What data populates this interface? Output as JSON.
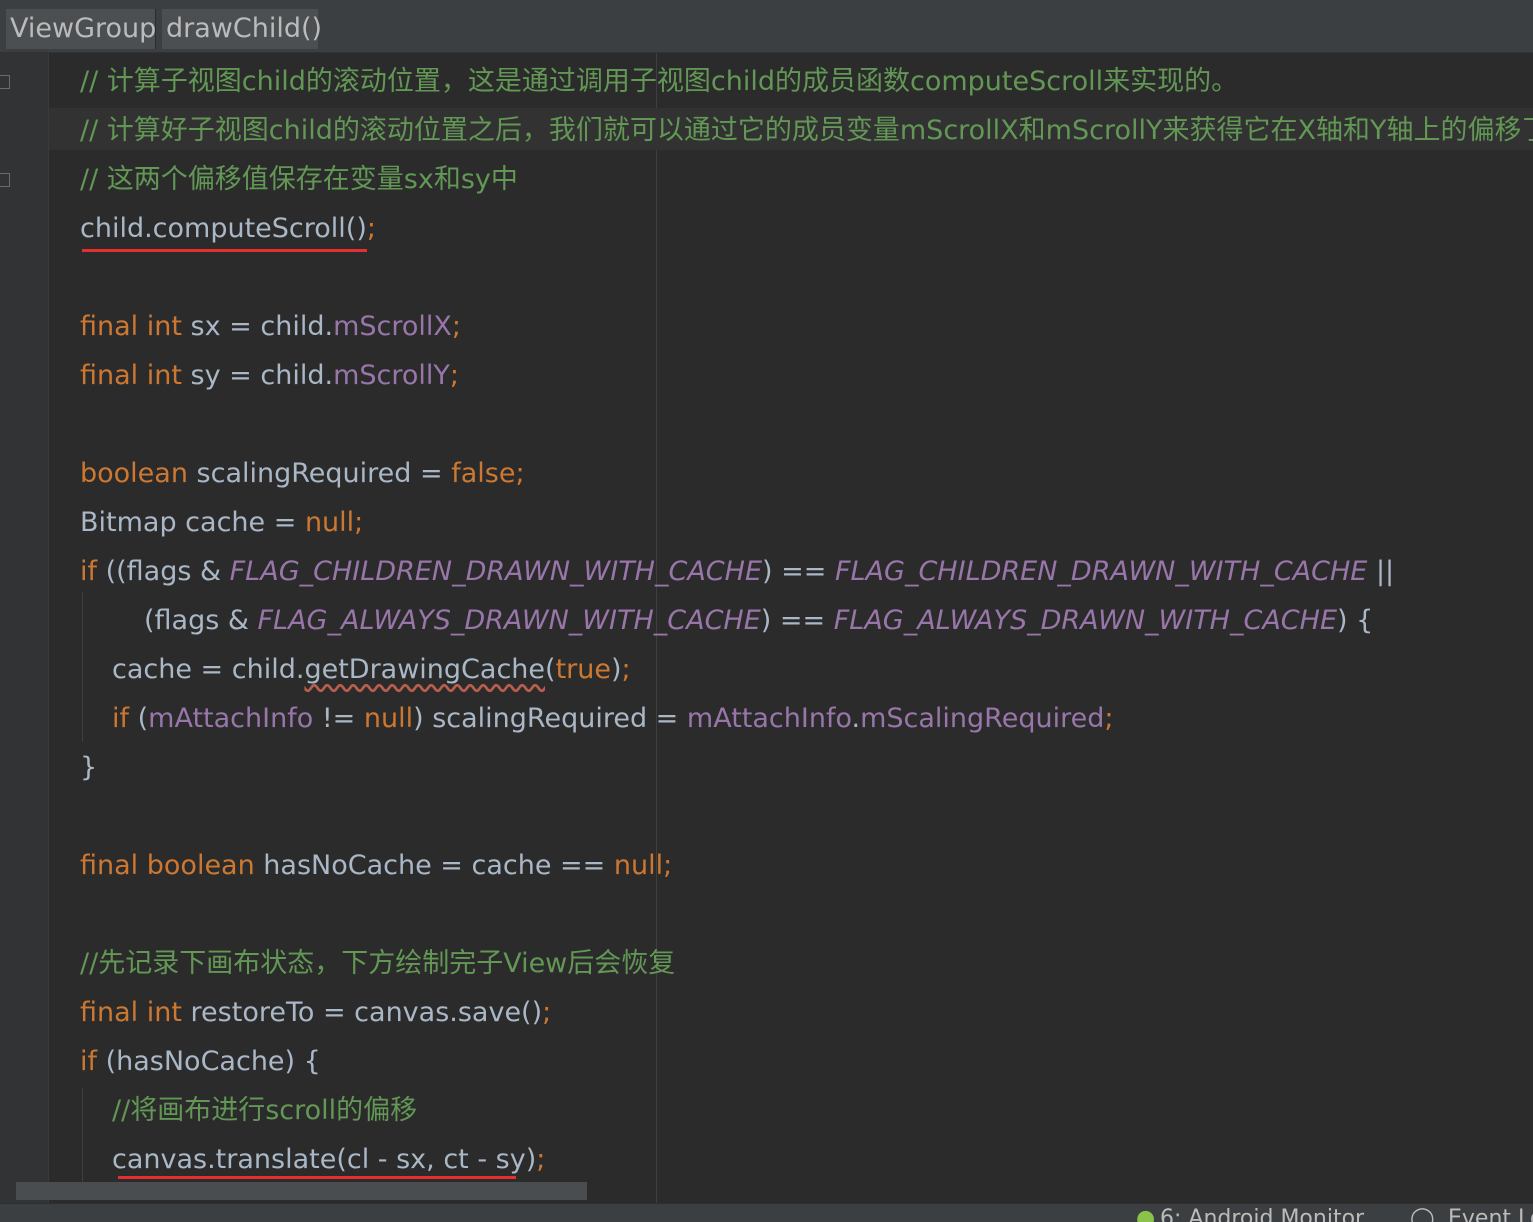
{
  "breadcrumb": {
    "items": [
      "ViewGroup",
      "drawChild()"
    ]
  },
  "code": {
    "comment1": "// 计算子视图child的滚动位置，这是通过调用子视图child的成员函数computeScroll来实现的。",
    "comment2": "// 计算好子视图child的滚动位置之后，我们就可以通过它的成员变量mScrollX和mScrollY来获得它在X轴和Y轴上的偏移了",
    "comment3": "// 这两个偏移值保存在变量sx和sy中",
    "call_compute": "child.computeScroll()",
    "semi": ";",
    "kw_final": "final",
    "kw_int": "int",
    "kw_boolean": "boolean",
    "kw_if": "if",
    "kw_false": "false",
    "kw_null": "null",
    "kw_true": "true",
    "sx_decl": " sx = child.",
    "sy_decl": " sy = child.",
    "m_scroll_x": "mScrollX",
    "m_scroll_y": "mScrollY",
    "scaling_decl": " scalingRequired = ",
    "bitmap_decl": "Bitmap cache = ",
    "if_open": " ((flags & ",
    "flag_children": "FLAG_CHILDREN_DRAWN_WITH_CACHE",
    "eq_op": ") == ",
    "or_op": " ||",
    "flags_open": "(flags & ",
    "flag_always": "FLAG_ALWAYS_DRAWN_WITH_CACHE",
    "brace_open": ") {",
    "cache_assign": "cache = child.",
    "get_drawing_cache": "getDrawingCache",
    "paren_open": "(",
    "paren_close": ")",
    "m_attach_info": "mAttachInfo",
    "neq_op": " != ",
    "scaling_assign": ") scalingRequired = ",
    "dot": ".",
    "m_scaling_required": "mScalingRequired",
    "brace_close": "}",
    "has_no_cache_decl": " hasNoCache = cache == ",
    "comment4": "//先记录下画布状态，下方绘制完子View后会恢复",
    "restore_decl": " restoreTo = canvas.save()",
    "if_has_no_cache": " (hasNoCache) {",
    "comment5": "//将画布进行scroll的偏移",
    "translate_call": "canvas.translate(cl - sx, ct - sy)"
  },
  "status": {
    "android_monitor": "6: Android Monitor",
    "event_log": "Event Log"
  },
  "colors": {
    "background": "#2b2b2b",
    "comment": "#629755",
    "keyword": "#cc7832",
    "field": "#9876aa",
    "text": "#a9b7c6",
    "highlight_underline": "#e52f2f"
  }
}
